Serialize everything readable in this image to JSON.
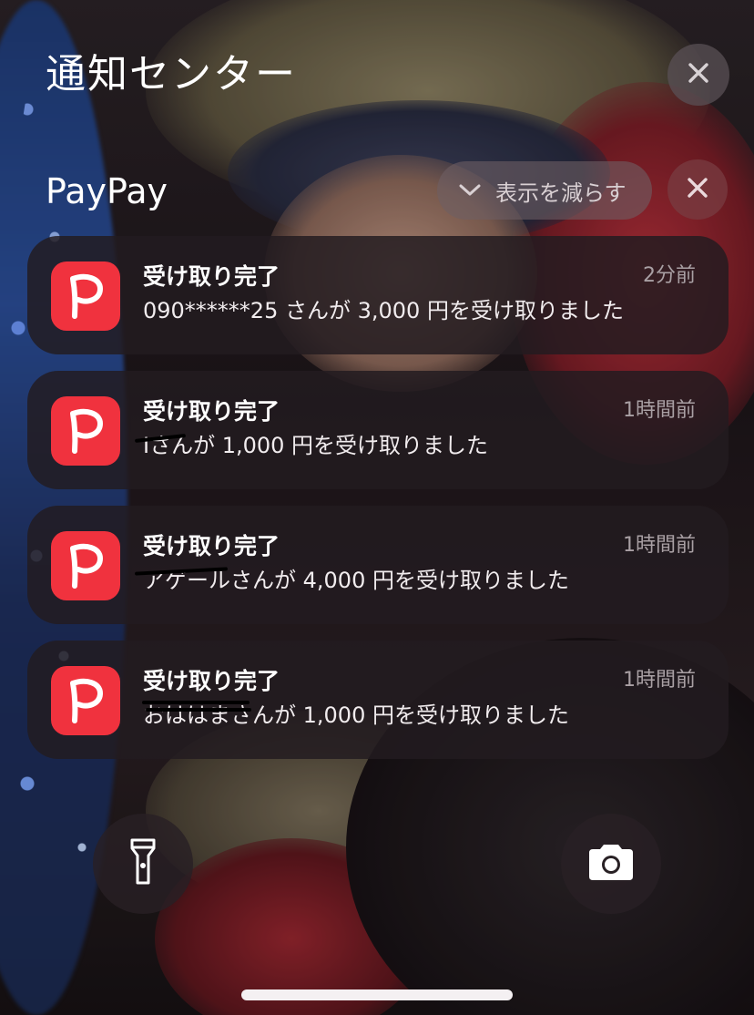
{
  "notification_center": {
    "title": "通知センター"
  },
  "group": {
    "app_name": "PayPay",
    "show_less_label": "表示を減らす"
  },
  "notifications": [
    {
      "app_icon": "paypay-icon",
      "title": "受け取り完了",
      "time": "2分前",
      "body": "090******25 さんが 3,000 円を受け取りました"
    },
    {
      "app_icon": "paypay-icon",
      "title": "受け取り完了",
      "time": "1時間前",
      "body": "Iさんが 1,000 円を受け取りました"
    },
    {
      "app_icon": "paypay-icon",
      "title": "受け取り完了",
      "time": "1時間前",
      "body": "アゲールさんが 4,000 円を受け取りました"
    },
    {
      "app_icon": "paypay-icon",
      "title": "受け取り完了",
      "time": "1時間前",
      "body": "おははまさんが 1,000 円を受け取りました"
    }
  ],
  "quick_actions": {
    "flashlight_icon": "flashlight-icon",
    "camera_icon": "camera-icon"
  },
  "colors": {
    "paypay_red": "#f0323e"
  }
}
